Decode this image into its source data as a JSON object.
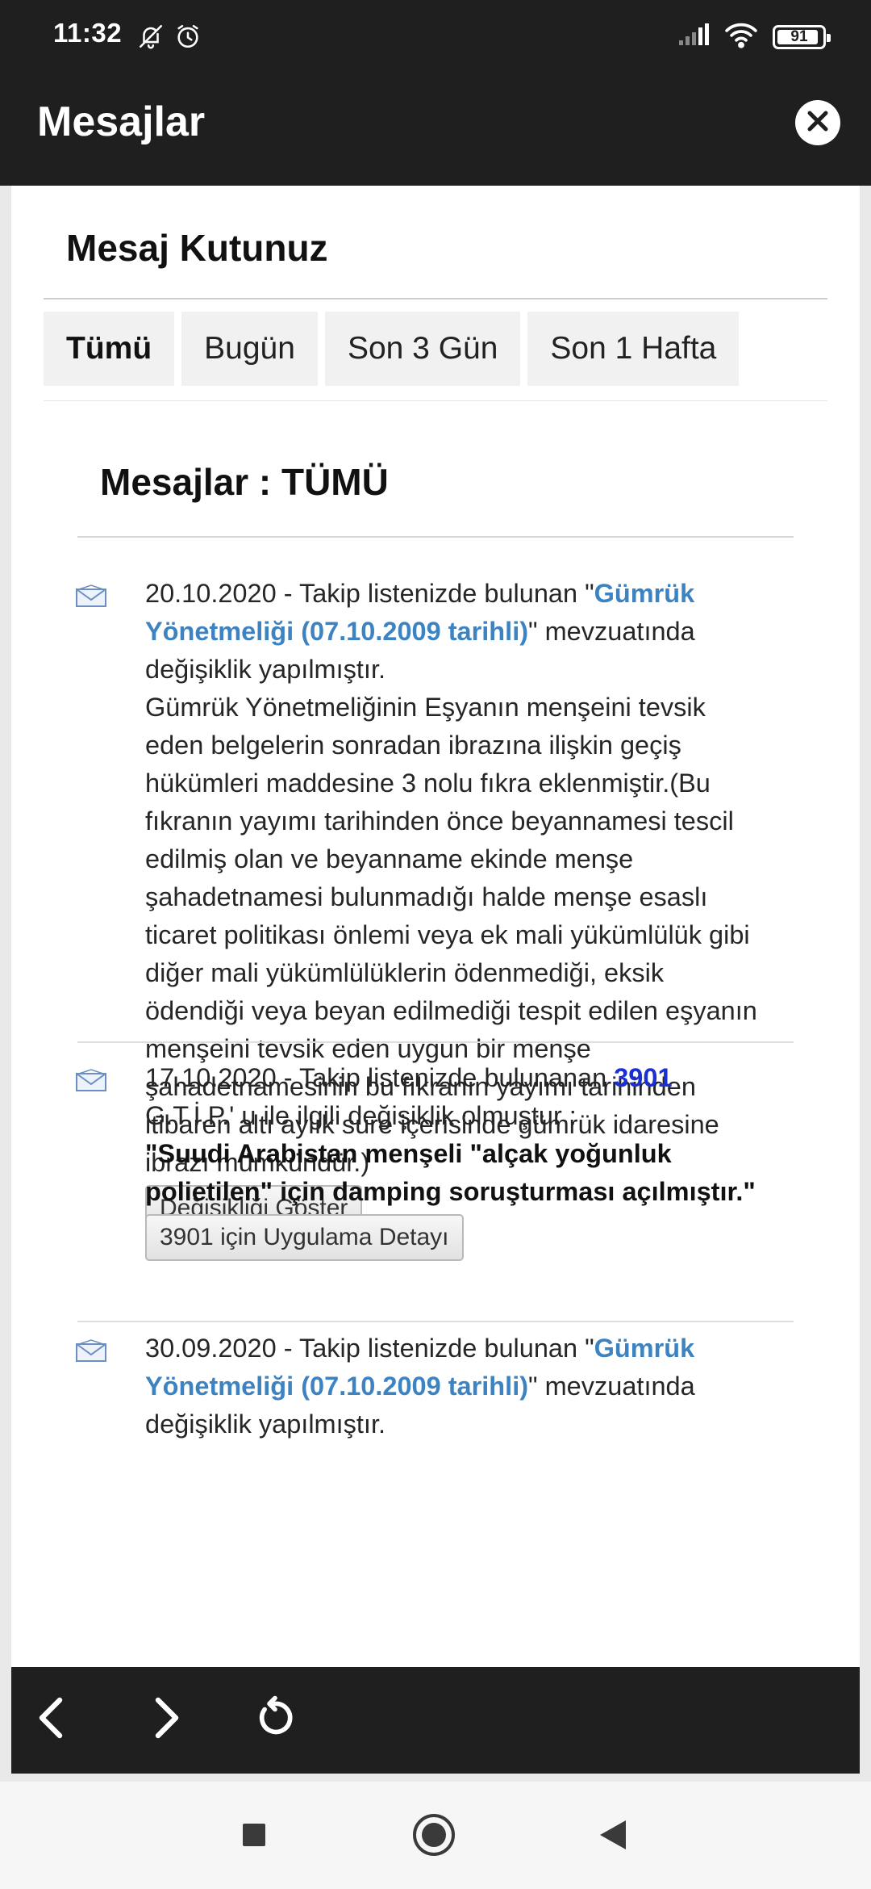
{
  "status_bar": {
    "time": "11:32",
    "battery": "91",
    "battery_level_percent": 91,
    "icons": [
      "bell-off-icon",
      "alarm-icon",
      "signal-icon",
      "wifi-icon",
      "battery-icon"
    ]
  },
  "app_bar": {
    "title": "Mesajlar",
    "close_icon": "close-icon"
  },
  "inbox": {
    "title": "Mesaj Kutunuz",
    "tabs": [
      {
        "label": "Tümü",
        "active": true
      },
      {
        "label": "Bugün",
        "active": false
      },
      {
        "label": "Son 3 Gün",
        "active": false
      },
      {
        "label": "Son 1 Hafta",
        "active": false
      }
    ],
    "list_title": "Mesajlar : TÜMÜ"
  },
  "messages": [
    {
      "icon": "envelope-icon",
      "prefix": "20.10.2020 - Takip listenizde bulunan \"",
      "link": "Gümrük Yönetmeliği (07.10.2009 tarihli)",
      "suffix": "\" mevzuatında değişiklik yapılmıştır.",
      "detail": "Gümrük Yönetmeliğinin Eşyanın menşeini tevsik eden belgelerin sonradan ibrazına ilişkin geçiş hükümleri maddesine 3 nolu fıkra eklenmiştir.(Bu fıkranın yayımı tarihinden önce beyannamesi tescil edilmiş olan ve beyanname ekinde menşe şahadetnamesi bulunmadığı halde menşe esaslı ticaret politikası önlemi veya ek mali yükümlülük gibi diğer mali yükümlülüklerin ödenmediği, eksik ödendiği veya beyan edilmediği tespit edilen eşyanın menşeini tevsik eden uygun bir menşe şahadetnamesinin bu fıkranın yayımı tarihinden itibaren altı aylık süre içerisinde gümrük idaresine ibrazı mümkündür.)",
      "button": "Değişikliği Göster"
    },
    {
      "icon": "envelope-icon",
      "prefix": "17.10.2020 - Takip listenizde bulunanan ",
      "code": "3901",
      "line2": "G.T.İ.P.' u ile ilgili değişiklik olmuştur :",
      "bold": "\"Suudi Arabistan menşeli \"alçak yoğunluk polietilen\" için damping soruşturması açılmıştır.\"",
      "button": "3901 için Uygulama Detayı"
    },
    {
      "icon": "envelope-icon",
      "prefix": "30.09.2020 - Takip listenizde bulunan \"",
      "link": "Gümrük Yönetmeliği (07.10.2009 tarihli)",
      "suffix": "\" mevzuatında değişiklik yapılmıştır."
    }
  ],
  "toolbar": {
    "back_icon": "chevron-left-icon",
    "forward_icon": "chevron-right-icon",
    "reload_icon": "reload-icon"
  },
  "system_nav": {
    "icons": [
      "recents-square-icon",
      "home-circle-icon",
      "back-triangle-icon"
    ]
  }
}
